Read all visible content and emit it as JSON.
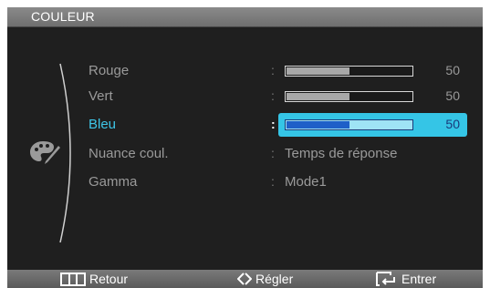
{
  "menu": {
    "title": "COULEUR",
    "items": [
      {
        "label": "Rouge",
        "type": "slider",
        "value": 50,
        "value_text": "50",
        "selected": false
      },
      {
        "label": "Vert",
        "type": "slider",
        "value": 50,
        "value_text": "50",
        "selected": false
      },
      {
        "label": "Bleu",
        "type": "slider",
        "value": 50,
        "value_text": "50",
        "selected": true
      },
      {
        "label": "Nuance coul.",
        "type": "text",
        "value_text": "Temps de réponse",
        "selected": false
      },
      {
        "label": "Gamma",
        "type": "text",
        "value_text": "Mode1",
        "selected": false
      }
    ],
    "separator": ":"
  },
  "footer": {
    "back_label": "Retour",
    "adjust_label": "Régler",
    "enter_label": "Entrer"
  },
  "colors": {
    "accent": "#35c5e6",
    "highlight_text": "#3ec6e8",
    "slider_fill": "#1f5fc8"
  },
  "icons": {
    "side": "palette-icon",
    "back": "menu-grid-icon",
    "adjust": "diamond-arrows-icon",
    "enter": "enter-icon"
  }
}
